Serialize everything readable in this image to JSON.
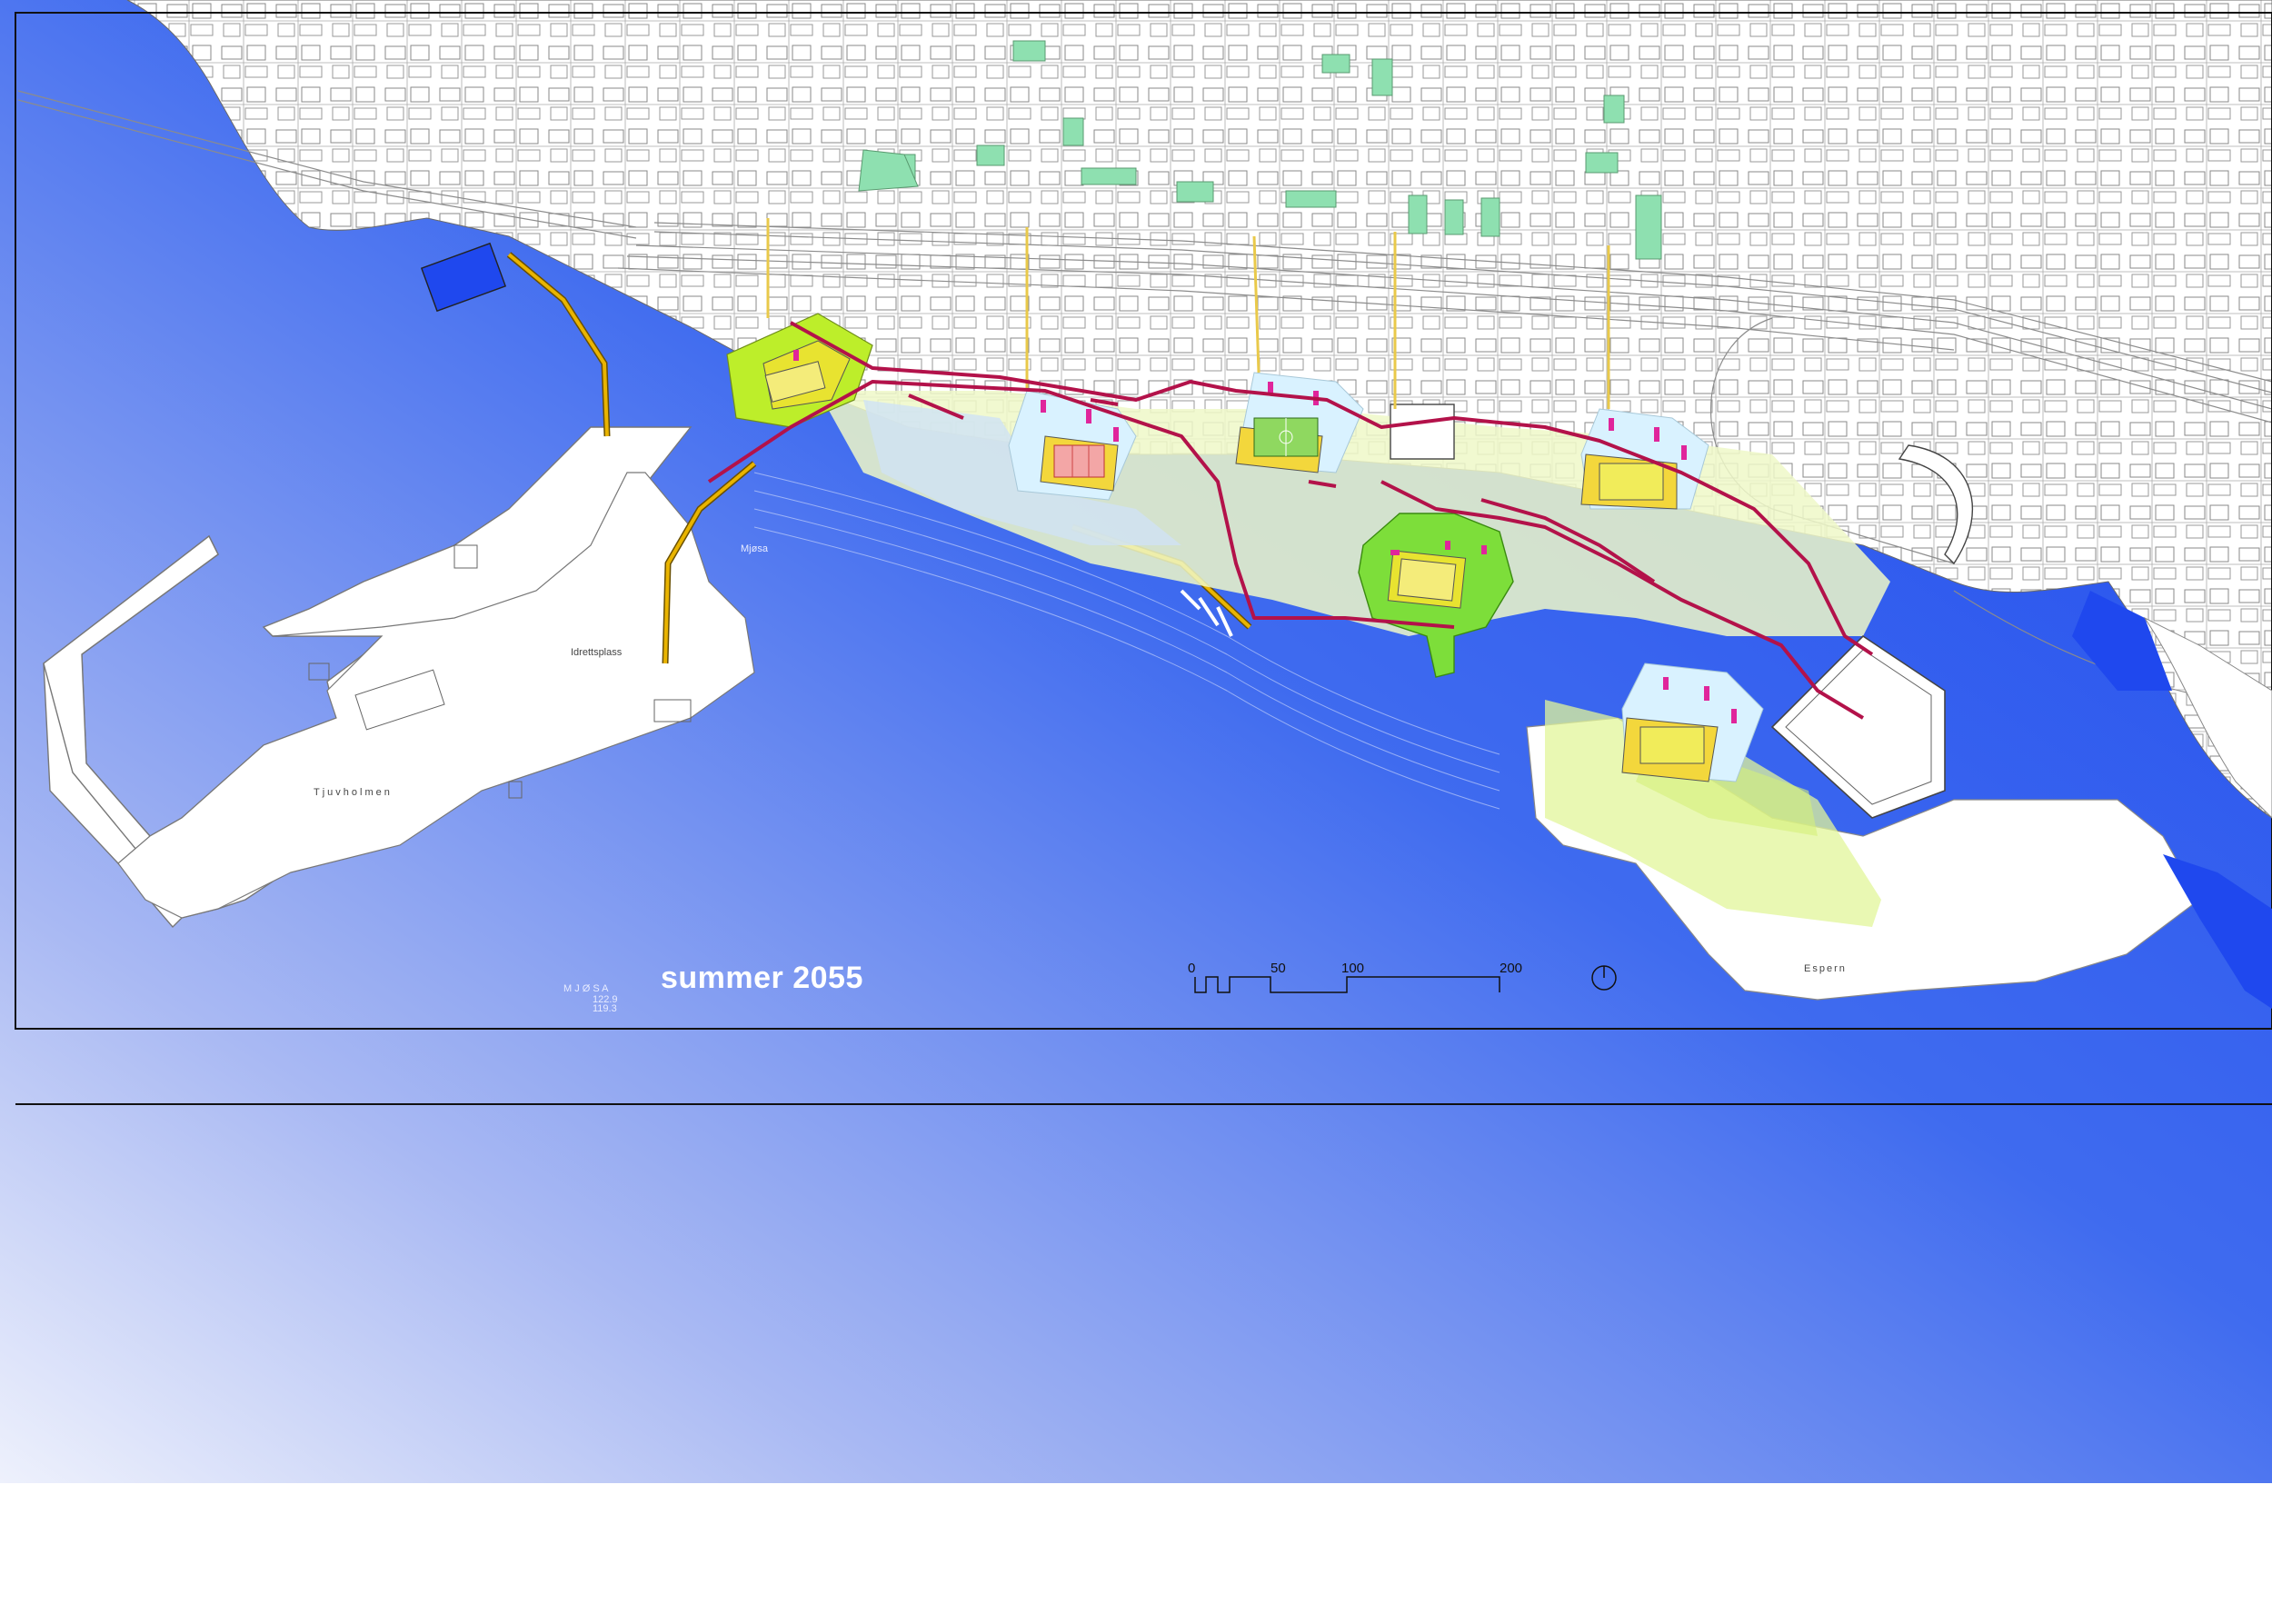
{
  "caption": "summer 2055",
  "scale_bar": {
    "ticks": [
      "0",
      "50",
      "100",
      "200"
    ]
  },
  "place_labels": {
    "west_island": "Tjuvholmen",
    "east_point": "Espern",
    "sports_field": "Idrettsplass",
    "bay": "Mjøsa"
  },
  "water_labels": [
    "M J Ø S A",
    "122.9",
    "119.3"
  ],
  "colors": {
    "water_deep": "#1f48ee",
    "water_light": "#dfe6fb",
    "land": "#ffffff",
    "green_zone": "#b9ef2a",
    "light_green": "#e6f7a8",
    "pale_blue": "#cfeaf2",
    "promenade": "#b3124a",
    "pier": "#e9b400",
    "seating": "#e0259b",
    "building_green": "#8ee0b0"
  },
  "icons": {
    "north_arrow": "north-arrow-icon"
  }
}
